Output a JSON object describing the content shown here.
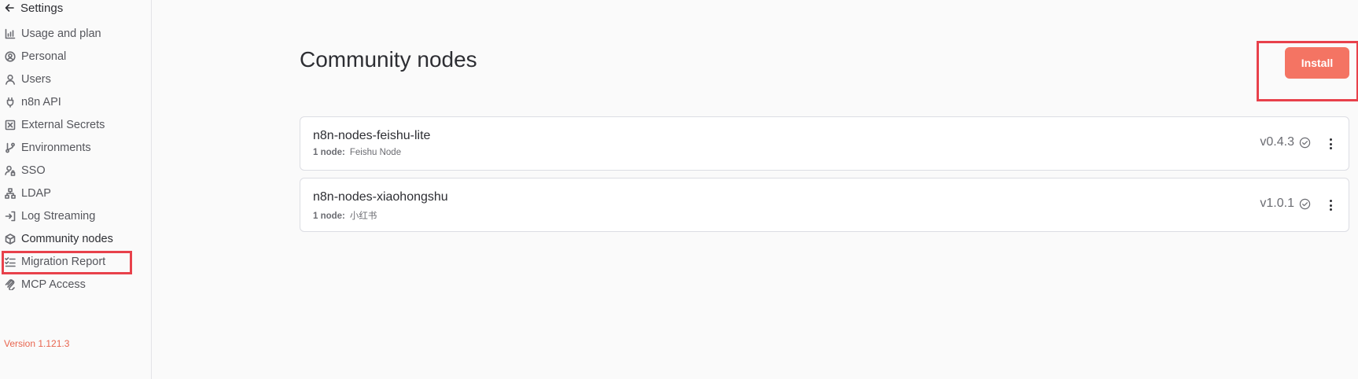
{
  "sidebar": {
    "back_label": "Settings",
    "items": [
      {
        "label": "Usage and plan",
        "icon": "chart-icon"
      },
      {
        "label": "Personal",
        "icon": "user-circle-icon"
      },
      {
        "label": "Users",
        "icon": "user-icon"
      },
      {
        "label": "n8n API",
        "icon": "plug-icon"
      },
      {
        "label": "External Secrets",
        "icon": "vault-icon"
      },
      {
        "label": "Environments",
        "icon": "branch-icon"
      },
      {
        "label": "SSO",
        "icon": "user-lock-icon"
      },
      {
        "label": "LDAP",
        "icon": "network-icon"
      },
      {
        "label": "Log Streaming",
        "icon": "sign-in-icon"
      },
      {
        "label": "Community nodes",
        "icon": "cube-icon",
        "active": true
      },
      {
        "label": "Migration Report",
        "icon": "list-checks-icon"
      },
      {
        "label": "MCP Access",
        "icon": "mcp-icon"
      }
    ],
    "version": "Version 1.121.3"
  },
  "main": {
    "title": "Community nodes",
    "install_label": "Install",
    "packages": [
      {
        "name": "n8n-nodes-feishu-lite",
        "count": "1 node:",
        "nodes": "Feishu Node",
        "version": "v0.4.3"
      },
      {
        "name": "n8n-nodes-xiaohongshu",
        "count": "1 node:",
        "nodes": "小红书",
        "version": "v1.0.1"
      }
    ]
  },
  "colors": {
    "accent": "#f47463",
    "highlight": "#e8414b",
    "version_text": "#e8654f"
  }
}
